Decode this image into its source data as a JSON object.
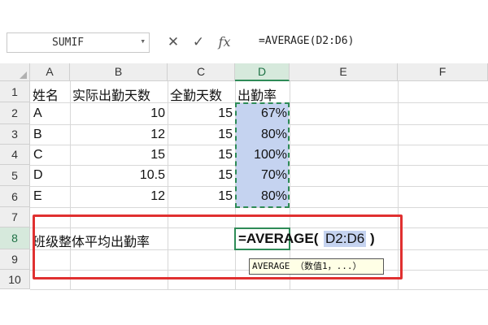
{
  "formula_bar": {
    "name_box": "SUMIF",
    "name_box_arrow": "▾",
    "cancel": "✕",
    "confirm": "✓",
    "fx": "fx",
    "formula": "=AVERAGE(D2:D6)"
  },
  "columns": [
    "A",
    "B",
    "C",
    "D",
    "E",
    "F"
  ],
  "rows": [
    "1",
    "2",
    "3",
    "4",
    "5",
    "6",
    "7",
    "8",
    "9",
    "10"
  ],
  "cells": {
    "A1": "姓名",
    "B1": "实际出勤天数",
    "C1": "全勤天数",
    "D1": "出勤率",
    "A2": "A",
    "B2": "10",
    "C2": "15",
    "D2": "67%",
    "A3": "B",
    "B3": "12",
    "C3": "15",
    "D3": "80%",
    "A4": "C",
    "B4": "15",
    "C4": "15",
    "D4": "100%",
    "A5": "D",
    "B5": "10.5",
    "C5": "15",
    "D5": "70%",
    "A6": "E",
    "B6": "12",
    "C6": "15",
    "D6": "80%",
    "A8": "班级整体平均出勤率"
  },
  "editing": {
    "prefix": "=AVERAGE(",
    "ref": "D2:D6",
    "suffix": ")"
  },
  "tooltip": "AVERAGE （数值1，...）",
  "colors": {
    "accent_green": "#2e8b57",
    "range_fill": "#c5d3f0",
    "annotation_red": "#e03030"
  }
}
